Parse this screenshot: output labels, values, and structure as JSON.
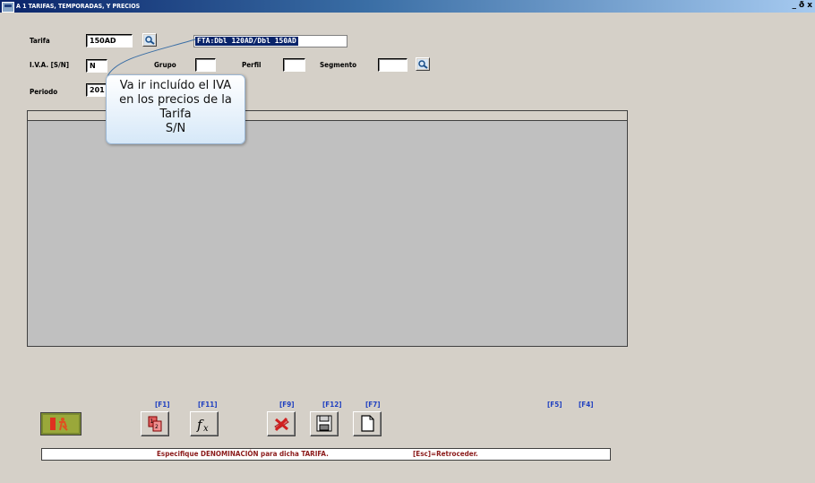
{
  "window": {
    "title": "A 1  TARIFAS, TEMPORADAS, Y PRECIOS",
    "controls": [
      "_",
      "ð",
      "x"
    ]
  },
  "form": {
    "tarifa_label": "Tarifa",
    "tarifa_value": "150AD",
    "tarifa_description": "FTA:Dbl 120AD/Dbl 150AD",
    "iva_label": "I.V.A. [S/N]",
    "iva_value": "N",
    "grupo_label": "Grupo",
    "grupo_value": "",
    "perfil_label": "Perfil",
    "perfil_value": "",
    "segmento_label": "Segmento",
    "segmento_value": "",
    "periodo_label": "Periodo",
    "periodo_value": "201"
  },
  "tooltip": {
    "lines": [
      "Va ir incluído el IVA",
      "en los precios de la",
      "Tarifa",
      "S/N"
    ]
  },
  "toolbar": {
    "f1": "[F1]",
    "f11": "[F11]",
    "f9": "[F9]",
    "f12": "[F12]",
    "f7": "[F7]",
    "f5": "[F5]",
    "f4": "[F4]",
    "icons": {
      "exit": "exit-icon",
      "f1": "reorder-icon",
      "f11": "function-icon",
      "f9": "delete-icon",
      "f12": "save-icon",
      "f7": "new-document-icon"
    }
  },
  "status": {
    "message": "Especifique DENOMINACIÓN para dicha TARIFA.",
    "hint": "[Esc]=Retroceder."
  },
  "colors": {
    "background": "#d5d0c8",
    "title_bar": "#0a246a",
    "fkey_text": "#2040c0",
    "status_text": "#8b1a1a",
    "grid_background": "#c0c0c0"
  }
}
